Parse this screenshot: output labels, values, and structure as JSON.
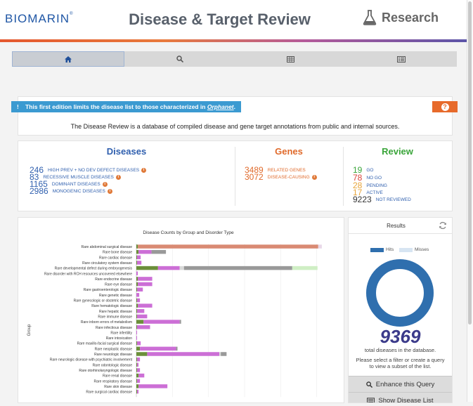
{
  "header": {
    "logo_text": "BIOMARIN",
    "logo_mark": "®",
    "title": "Disease & Target Review",
    "section": "Research",
    "icons": [
      "flask-icon"
    ]
  },
  "nav": {
    "tabs": [
      {
        "icon": "home-icon",
        "active": true
      },
      {
        "icon": "search-icon",
        "active": false
      },
      {
        "icon": "table-icon",
        "active": false
      },
      {
        "icon": "list-icon",
        "active": false
      }
    ]
  },
  "notice": {
    "bang": "!",
    "flag_text": "This first edition limits the disease list to those characterized in",
    "flag_link": "Orphanet",
    "flag_end": ".",
    "help_icon": "?",
    "text": "The Disease Review is a database of compiled disease and gene target annotations from public and internal sources."
  },
  "stats": {
    "diseases": {
      "title": "Diseases",
      "rows": [
        {
          "value": "246",
          "label": "High prev + no dev defect diseases"
        },
        {
          "value": "83",
          "label": "Recessive muscle diseases"
        },
        {
          "value": "1165",
          "label": "Dominant diseases"
        },
        {
          "value": "2986",
          "label": "Monogenic diseases"
        }
      ]
    },
    "genes": {
      "title": "Genes",
      "rows": [
        {
          "value": "3489",
          "label": "Related genes"
        },
        {
          "value": "3072",
          "label": "Disease-causing"
        }
      ]
    },
    "review": {
      "title": "Review",
      "rows": [
        {
          "value": "19",
          "label": "Go",
          "color": "#3aa53a"
        },
        {
          "value": "78",
          "label": "No go",
          "color": "#d9443b"
        },
        {
          "value": "28",
          "label": "Pending",
          "color": "#e8a53a"
        },
        {
          "value": "17",
          "label": "Active",
          "color": "#e8a53a"
        },
        {
          "value": "9223",
          "label": "Not reviewed",
          "color": "#333333"
        }
      ]
    },
    "info_glyph": "i",
    "colors": {
      "diseases": "#2f5fae",
      "genes": "#e06a2b",
      "review": "#3aa53a"
    }
  },
  "chart_data": {
    "type": "bar",
    "stacked": true,
    "orientation": "horizontal",
    "title": "Disease Counts by Group and Disorder Type",
    "ylabel": "Group",
    "categories": [
      "Rare abdominal surgical disease",
      "Rare bone disease",
      "Rare cardiac disease",
      "Rare circulatory system disease",
      "Rare developmental defect during embryogenesis",
      "Rare disorder with RCH resources uncovered elsewhere",
      "Rare endocrine disease",
      "Rare eye disease",
      "Rare gastroenterologic disease",
      "Rare genetic disease",
      "Rare gynecologic or obstetric disease",
      "Rare hematologic disease",
      "Rare hepatic disease",
      "Rare immune disease",
      "Rare inborn errors of metabolism",
      "Rare infectious disease",
      "Rare infertility",
      "Rare intoxication",
      "Rare maxillo-facial surgical disease",
      "Rare neoplastic disease",
      "Rare neurologic disease",
      "Rare neurologic disease with psychiatric involvement",
      "Rare odontologic disease",
      "Rare otorhinolaryngologic disease",
      "Rare renal disease",
      "Rare respiratory disease",
      "Rare skin disease",
      "Rare surgical cardiac disease"
    ],
    "series": [
      {
        "color": "#6b8f3a",
        "values": [
          2,
          3,
          1,
          1,
          30,
          0,
          2,
          2,
          1,
          0,
          1,
          2,
          1,
          1,
          10,
          1,
          0,
          0,
          1,
          5,
          15,
          1,
          1,
          1,
          3,
          1,
          3,
          1
        ]
      },
      {
        "color": "#cc6fd6",
        "values": [
          0,
          18,
          5,
          6,
          30,
          2,
          20,
          20,
          8,
          4,
          4,
          20,
          10,
          14,
          50,
          18,
          1,
          1,
          5,
          50,
          100,
          4,
          2,
          4,
          8,
          4,
          40,
          2
        ]
      },
      {
        "color": "#d9d9d9",
        "values": [
          0,
          0,
          0,
          0,
          6,
          0,
          0,
          0,
          0,
          0,
          0,
          0,
          0,
          0,
          0,
          0,
          0,
          0,
          0,
          0,
          2,
          0,
          0,
          0,
          0,
          0,
          0,
          0
        ]
      },
      {
        "color": "#999999",
        "values": [
          0,
          20,
          0,
          0,
          150,
          0,
          0,
          0,
          0,
          0,
          0,
          0,
          0,
          0,
          2,
          0,
          0,
          0,
          0,
          2,
          8,
          0,
          0,
          0,
          0,
          0,
          0,
          0
        ]
      },
      {
        "color": "#cfeec4",
        "values": [
          0,
          0,
          0,
          0,
          35,
          0,
          0,
          0,
          0,
          0,
          0,
          0,
          0,
          0,
          0,
          0,
          0,
          0,
          0,
          0,
          0,
          0,
          0,
          0,
          0,
          0,
          0,
          0
        ]
      },
      {
        "color": "#d98a73",
        "values": [
          250,
          0,
          0,
          0,
          0,
          0,
          0,
          0,
          0,
          0,
          0,
          0,
          0,
          0,
          0,
          0,
          0,
          0,
          0,
          0,
          0,
          0,
          0,
          0,
          0,
          0,
          0,
          0
        ]
      },
      {
        "color": "#e8d8e8",
        "values": [
          5,
          0,
          0,
          0,
          0,
          0,
          0,
          0,
          0,
          0,
          0,
          0,
          0,
          0,
          0,
          0,
          0,
          0,
          0,
          0,
          0,
          0,
          0,
          0,
          0,
          0,
          0,
          0
        ]
      }
    ],
    "xlim": [
      0,
      260
    ],
    "grid": true
  },
  "results": {
    "title": "Results",
    "legend": [
      {
        "label": "Hits",
        "color": "#2f6fae"
      },
      {
        "label": "Misses",
        "color": "#d7e5f2"
      }
    ],
    "hits_fraction": 1,
    "count": "9369",
    "caption": "total diseases in the database.",
    "hint": "Please select a filter or create a query to view a subset of the list.",
    "enhance_label": "Enhance this Query",
    "show_label": "Show Disease List"
  }
}
